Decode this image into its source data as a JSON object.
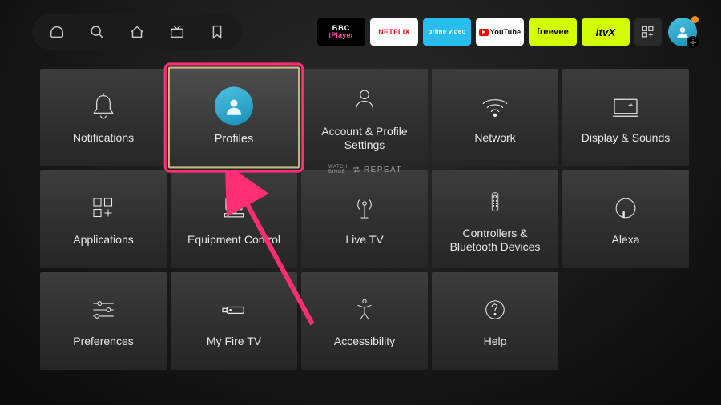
{
  "topbar": {
    "nav_icons": [
      "home-icon",
      "search-icon",
      "house-icon",
      "tv-icon",
      "bookmark-icon"
    ],
    "apps": [
      {
        "id": "iplayer",
        "label_a": "BBC",
        "label_b": "iPlayer"
      },
      {
        "id": "netflix",
        "label": "NETFLIX"
      },
      {
        "id": "prime",
        "label": "prime video"
      },
      {
        "id": "youtube",
        "label": "YouTube"
      },
      {
        "id": "freevee",
        "label": "freevee"
      },
      {
        "id": "itvx",
        "label": "itvX"
      }
    ]
  },
  "tiles": {
    "notifications": "Notifications",
    "profiles": "Profiles",
    "account": "Account & Profile Settings",
    "network": "Network",
    "display": "Display & Sounds",
    "applications": "Applications",
    "equipment": "Equipment Control",
    "livetv": "Live TV",
    "controllers": "Controllers & Bluetooth Devices",
    "alexa": "Alexa",
    "preferences": "Preferences",
    "myfiretv": "My Fire TV",
    "accessibility": "Accessibility",
    "help": "Help"
  },
  "watermark": {
    "brand_a": "WATCH",
    "brand_b": "BINGE",
    "text": "REPEAT"
  },
  "selected_tile": "profiles",
  "colors": {
    "highlight": "#ff2e74",
    "accent": "#4cc2e0"
  }
}
